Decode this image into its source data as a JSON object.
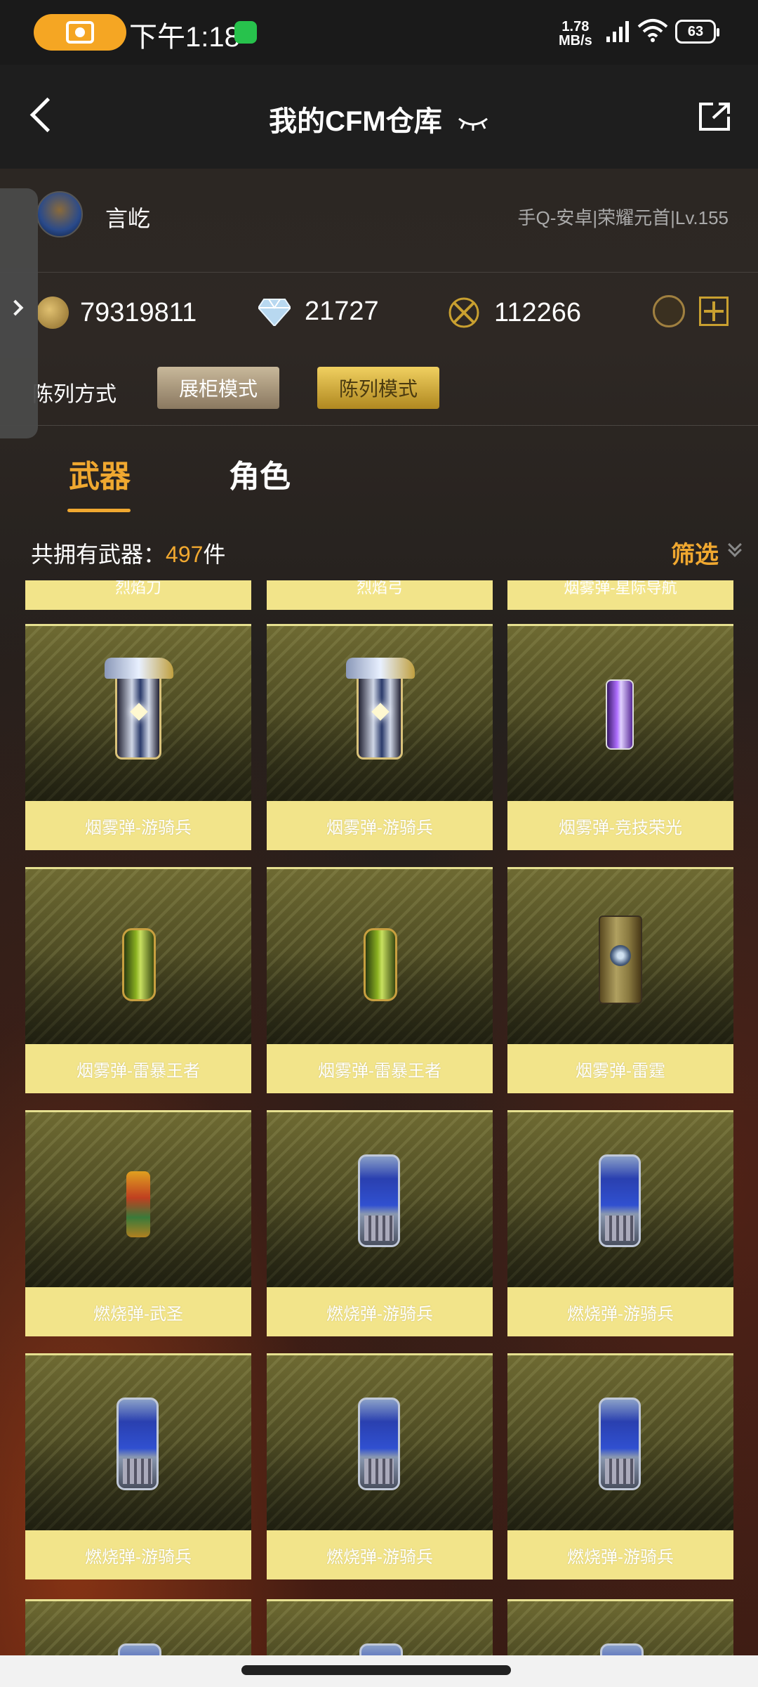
{
  "status_bar": {
    "time": "下午1:18",
    "net_speed_value": "1.78",
    "net_speed_unit": "MB/s",
    "battery": "63"
  },
  "header": {
    "title": "我的CFM仓库"
  },
  "profile": {
    "username": "言屹",
    "account_info": "手Q-安卓|荣耀元首|Lv.155"
  },
  "currency": {
    "coins": "79319811",
    "diamonds": "21727",
    "medals": "112266"
  },
  "display": {
    "label": "陈列方式",
    "cabinet_mode": "展柜模式",
    "list_mode": "陈列模式",
    "active": "陈列模式"
  },
  "tabs": {
    "weapons": "武器",
    "roles": "角色",
    "active": "武器"
  },
  "inventory": {
    "count_prefix": "共拥有武器：",
    "count": "497",
    "count_suffix": "件",
    "filter_label": "筛选"
  },
  "items_partial_top": [
    "烈焰刀",
    "烈焰弓",
    "烟雾弹-星际导航"
  ],
  "items": [
    {
      "name": "烟雾弹-游骑兵",
      "icon": "ranger-smoke-grenade"
    },
    {
      "name": "烟雾弹-游骑兵",
      "icon": "ranger-smoke-grenade"
    },
    {
      "name": "烟雾弹-竞技荣光",
      "icon": "glory-smoke-grenade"
    },
    {
      "name": "烟雾弹-雷暴王者",
      "icon": "storm-smoke-grenade"
    },
    {
      "name": "烟雾弹-雷暴王者",
      "icon": "storm-smoke-grenade"
    },
    {
      "name": "烟雾弹-雷霆",
      "icon": "thunder-smoke-grenade"
    },
    {
      "name": "燃烧弹-武圣",
      "icon": "wusheng-incendiary"
    },
    {
      "name": "燃烧弹-游骑兵",
      "icon": "ranger-incendiary"
    },
    {
      "name": "燃烧弹-游骑兵",
      "icon": "ranger-incendiary"
    },
    {
      "name": "燃烧弹-游骑兵",
      "icon": "ranger-incendiary"
    },
    {
      "name": "燃烧弹-游骑兵",
      "icon": "ranger-incendiary"
    },
    {
      "name": "燃烧弹-游骑兵",
      "icon": "ranger-incendiary"
    }
  ],
  "colors": {
    "accent": "#f0a830",
    "card_label_bg": "#f2e48a",
    "card_art_bg": "#5a5628"
  }
}
